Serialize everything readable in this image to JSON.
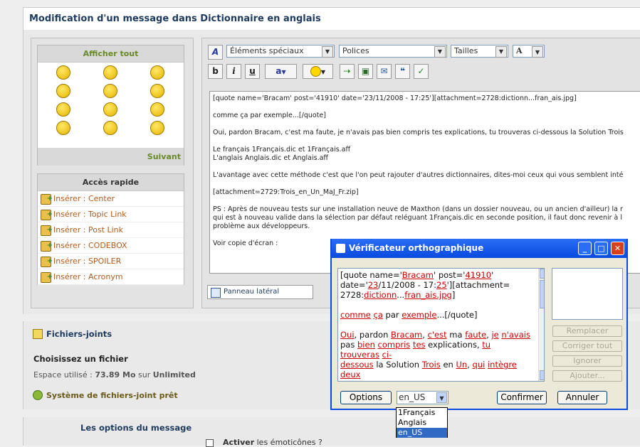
{
  "page": {
    "title": "Modification d'un message dans Dictionnaire en anglais"
  },
  "smileys": {
    "header": "Afficher tout",
    "footer": "Suivant"
  },
  "quick": {
    "header": "Accès rapide",
    "items": [
      "Insérer : Center",
      "Insérer : Topic Link",
      "Insérer : Post Link",
      "Insérer : CODEBOX",
      "Insérer : SPOILER",
      "Insérer : Acronym"
    ]
  },
  "toolbar": {
    "special": "Éléments spéciaux",
    "fonts": "Polices",
    "sizes": "Tailles",
    "bold": "b",
    "italic": "i",
    "underline": "u",
    "color_glyph": "A"
  },
  "editor": {
    "text": "[quote name='Bracam' post='41910' date='23/11/2008 - 17:25'][attachment=2728:dictionn...fran_ais.jpg]\n\ncomme ça par exemple...[/quote]\n\nOui, pardon Bracam, c'est ma faute, je n'avais pas bien compris tes explications, tu trouveras ci-dessous la Solution Trois\n\nLe français 1Français.dic et 1Français.aff\nL'anglais Anglais.dic et Anglais.aff\n\nL'avantage avec cette méthode c'est que l'on peut rajouter d'autres dictionnaires, dites-moi ceux qui vous semblent inté\n\n[attachment=2729:Trois_en_Un_MaJ_Fr.zip]\n\nPS : Après de nouveau tests sur une installation neuve de Maxthon (dans un dossier nouveau, ou un ancien d'ailleur) la r\nqui est à nouveau valide dans la sélection par défaut reléguant 1Français.dic en seconde position, il faut donc revenir à l\nproblème aux développeurs.\n\nVoir copie d'écran :",
    "side_panel": "Panneau latéral"
  },
  "attachments": {
    "title": "Fichiers-joints",
    "choose": "Choisissez un fichier",
    "space_label": "Espace utilisé :",
    "space_value": "73.89 Mo",
    "space_sep": "sur",
    "space_limit": "Unlimited",
    "ready": "Système de fichiers-joint prêt"
  },
  "options": {
    "title": "Les options du message",
    "enable": "Activer",
    "enable_rest": "les émoticônes ?"
  },
  "spell": {
    "title": "Vérificateur orthographique",
    "replace": "Remplacer",
    "correct_all": "Corriger tout",
    "ignore": "Ignorer",
    "add": "Ajouter...",
    "options": "Options",
    "lang_selected": "en_US",
    "confirm": "Confirmer",
    "cancel": "Annuler",
    "languages": [
      "1Français",
      "Anglais",
      "en_US"
    ]
  },
  "colors": {
    "titlebar": "#0a4ae0",
    "error": "#cc0000",
    "link": "#b05a1a",
    "heading": "#6a8a2a"
  }
}
